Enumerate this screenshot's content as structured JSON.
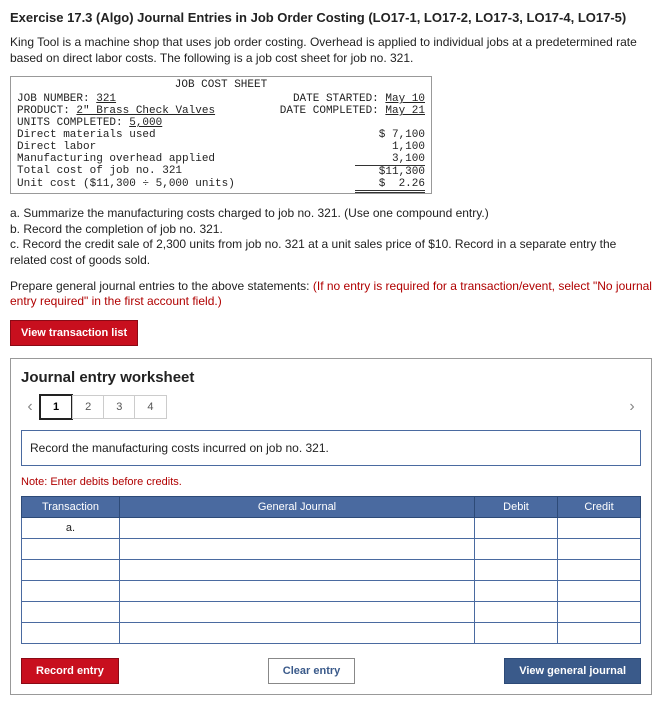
{
  "title": "Exercise 17.3 (Algo) Journal Entries in Job Order Costing (LO17-1, LO17-2, LO17-3, LO17-4, LO17-5)",
  "intro": "King Tool is a machine shop that uses job order costing. Overhead is applied to individual jobs at a predetermined rate based on direct labor costs. The following is a job cost sheet for job no. 321.",
  "sheet": {
    "header": "JOB COST SHEET",
    "job_number_label": "JOB NUMBER:",
    "job_number": "321",
    "date_started_label": "DATE STARTED:",
    "date_started": "May 10",
    "product_label": "PRODUCT:",
    "product": "2\" Brass Check Valves",
    "date_completed_label": "DATE COMPLETED:",
    "date_completed": "May 21",
    "units_completed_label": "UNITS COMPLETED:",
    "units_completed": "5,000",
    "lines": [
      {
        "label": "Direct materials used",
        "value": "$ 7,100"
      },
      {
        "label": "Direct labor",
        "value": "1,100"
      },
      {
        "label": "Manufacturing overhead applied",
        "value": "3,100"
      },
      {
        "label": "Total cost of job no. 321",
        "value": "$11,300"
      },
      {
        "label": "Unit cost ($11,300 ÷ 5,000 units)",
        "value": "$  2.26"
      }
    ]
  },
  "questions": {
    "a": "a. Summarize the manufacturing costs charged to job no. 321. (Use one compound entry.)",
    "b": "b. Record the completion of job no. 321.",
    "c": "c. Record the credit sale of 2,300 units from job no. 321 at a unit sales price of $10. Record in a separate entry the related cost of goods sold."
  },
  "prepare": "Prepare general journal entries to the above statements: ",
  "prepare_red": "(If no entry is required for a transaction/event, select \"No journal entry required\" in the first account field.)",
  "view_btn": "View transaction list",
  "worksheet": {
    "title": "Journal entry worksheet",
    "tabs": [
      "1",
      "2",
      "3",
      "4"
    ],
    "instruction": "Record the manufacturing costs incurred on job no. 321.",
    "note": "Note: Enter debits before credits.",
    "columns": [
      "Transaction",
      "General Journal",
      "Debit",
      "Credit"
    ],
    "first_cell": "a.",
    "record_btn": "Record entry",
    "clear_btn": "Clear entry",
    "view_general_btn": "View general journal"
  }
}
